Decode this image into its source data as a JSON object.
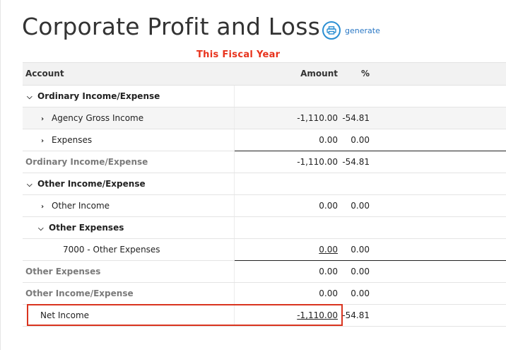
{
  "page": {
    "title": "Corporate Profit and Loss",
    "generate_label": "generate",
    "subtitle": "This Fiscal Year"
  },
  "table": {
    "columns": {
      "account": "Account",
      "amount": "Amount",
      "percent": "%"
    },
    "rows": [
      {
        "label": "Ordinary Income/Expense",
        "amount": "",
        "percent": "",
        "type": "group",
        "chevron": "down"
      },
      {
        "label": "Agency Gross Income",
        "amount": "-1,110.00",
        "percent": "-54.81",
        "type": "item",
        "chevron": "right"
      },
      {
        "label": "Expenses",
        "amount": "0.00",
        "percent": "0.00",
        "type": "item",
        "chevron": "right"
      },
      {
        "label": "Ordinary Income/Expense",
        "amount": "-1,110.00",
        "percent": "-54.81",
        "type": "total"
      },
      {
        "label": "Other Income/Expense",
        "amount": "",
        "percent": "",
        "type": "group",
        "chevron": "down"
      },
      {
        "label": "Other Income",
        "amount": "0.00",
        "percent": "0.00",
        "type": "item",
        "chevron": "right"
      },
      {
        "label": "Other Expenses",
        "amount": "",
        "percent": "",
        "type": "subgroup",
        "chevron": "down"
      },
      {
        "label": "7000 - Other Expenses",
        "amount": "0.00",
        "percent": "0.00",
        "type": "leaf"
      },
      {
        "label": "Other Expenses",
        "amount": "0.00",
        "percent": "0.00",
        "type": "total"
      },
      {
        "label": "Other Income/Expense",
        "amount": "0.00",
        "percent": "0.00",
        "type": "total"
      },
      {
        "label": "Net Income",
        "amount": "-1,110.00",
        "percent": "-54.81",
        "type": "net"
      }
    ]
  },
  "colors": {
    "accent": "#2b8fd3",
    "subtitle": "#e8321c",
    "highlight": "#d9341f"
  },
  "icons": {
    "generate": "printer-icon",
    "expanded": "chevron-down-icon",
    "collapsed": "chevron-right-icon"
  }
}
